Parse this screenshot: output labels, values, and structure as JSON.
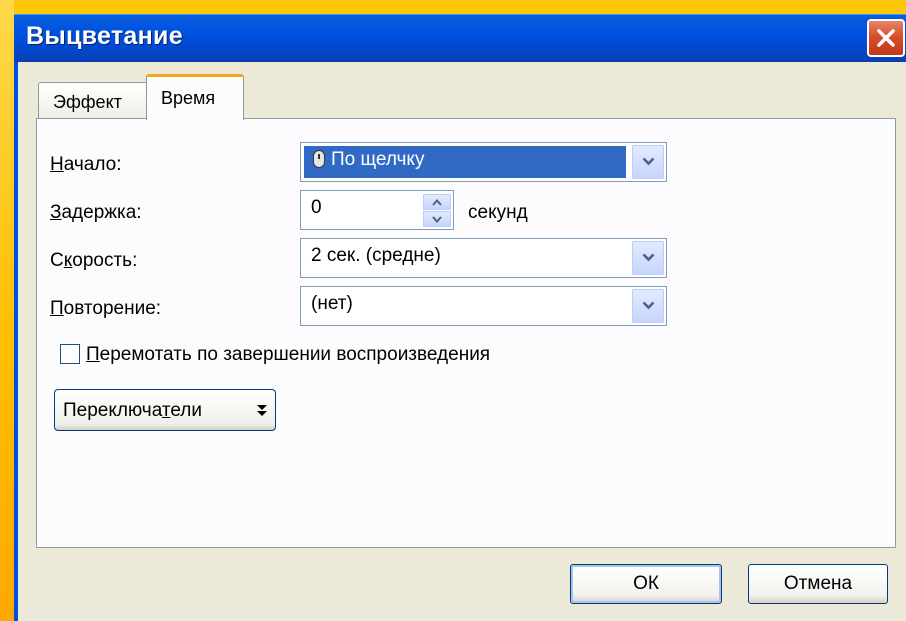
{
  "dialog": {
    "title": "Выцветание",
    "close_icon": "close-icon"
  },
  "tabs": [
    {
      "label": "Эффект",
      "active": false
    },
    {
      "label": "Время",
      "active": true
    }
  ],
  "form": {
    "start": {
      "label_key": "Н",
      "label_rest": "ачало:",
      "value": "По щелчку",
      "icon": "mouse-icon"
    },
    "delay": {
      "label_key": "З",
      "label_rest": "адержка:",
      "value": "0",
      "unit": "секунд"
    },
    "speed": {
      "label_pre": "С",
      "label_key": "к",
      "label_rest": "орость:",
      "value": "2 сек. (средне)"
    },
    "repeat": {
      "label_key": "П",
      "label_rest": "овторение:",
      "value": "(нет)"
    },
    "rewind": {
      "label_key": "П",
      "label_rest": "еремотать по завершении воспроизведения",
      "checked": false
    },
    "triggers": {
      "label_pre": "Переключа",
      "label_key": "т",
      "label_rest": "ели",
      "icon": "double-chevron-down-icon"
    }
  },
  "buttons": {
    "ok": "ОК",
    "cancel": "Отмена"
  },
  "colors": {
    "titlebar": "#0054e3",
    "close": "#d7502a",
    "selection": "#316ac5",
    "active_tab_accent": "#f5a623",
    "desktop": "#ffc000"
  }
}
